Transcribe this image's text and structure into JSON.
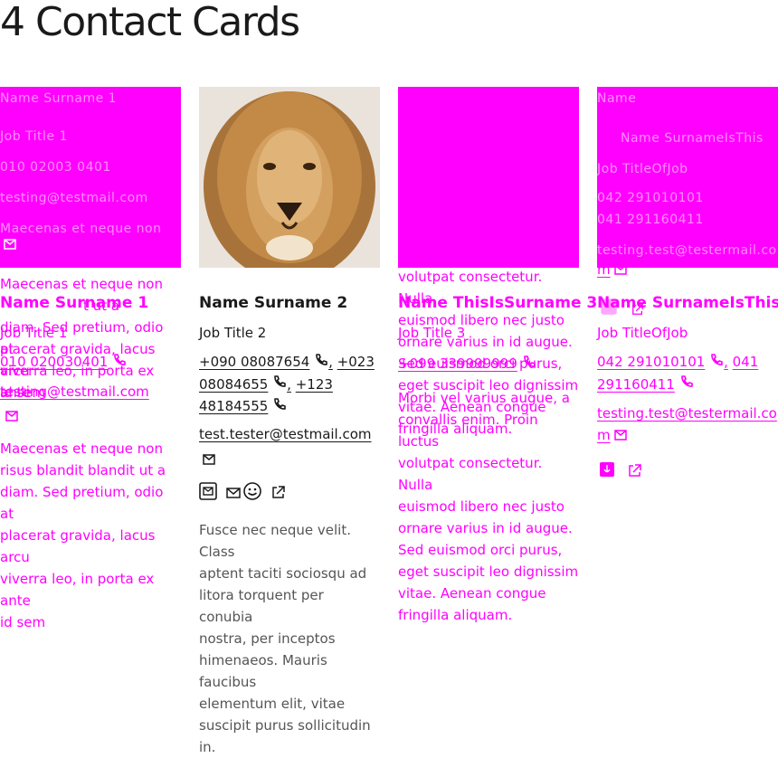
{
  "page": {
    "title": "4 Contact Cards"
  },
  "colors": {
    "missing_image": "#ff00ff",
    "text": "#1a1a1a",
    "muted": "#555555"
  },
  "icons": [
    "phone-icon",
    "mail-icon",
    "smiley-icon",
    "external-link-icon"
  ],
  "card1": {
    "glitch_lines": [
      "Name Surname 1",
      "Job Title 1",
      "010 02003 0401",
      "testing@testmail.com",
      "Maecenas et neque non"
    ],
    "text_top": "Maecenas et neque non",
    "text_top_2": "risus blandit blandit ut a",
    "name": "Name Surname 1",
    "job_title": "Job Title 1",
    "body_overlay": [
      "diam. Sed pretium, odio at",
      "placerat gravida, lacus arcu",
      "viverra leo, in porta ex ante",
      "id sem"
    ],
    "phone": "010 020030401",
    "email": "testing@testmail.com",
    "description": [
      "Maecenas et neque non",
      "risus blandit blandit ut a",
      "diam. Sed pretium, odio at",
      "placerat gravida, lacus arcu",
      "viverra leo, in porta ex ante",
      "id sem"
    ]
  },
  "card2": {
    "name": "Name Surname 2",
    "job_title": "Job Title 2",
    "phones": [
      "+090 08087654",
      "+023 08084655",
      "+123 48184555"
    ],
    "email": "test.tester@testmail.com",
    "description": [
      "Fusce nec neque velit. Class",
      "aptent taciti sociosqu ad",
      "litora torquent per conubia",
      "nostra, per inceptos",
      "himenaeos. Mauris faucibus",
      "elementum elit, vitae",
      "suscipit purus sollicitudin",
      "in."
    ]
  },
  "card3": {
    "name": "Name ThisIsSurname 3",
    "job_title": "Job Title 3",
    "phone": "+099 339999999",
    "text_lines": [
      "volutpat consectetur. Nulla",
      "euismod libero nec justo",
      "ornare varius in id augue.",
      "Sed euismod orci purus,",
      "eget suscipit leo dignissim",
      "vitae. Aenean congue",
      "fringilla aliquam.",
      "Morbi vel varius augue, a",
      "convallis enim. Proin luctus",
      "volutpat consectetur. Nulla",
      "euismod libero nec justo",
      "ornare varius in id augue.",
      "Sed euismod orci purus,",
      "eget suscipit leo dignissim",
      "vitae. Aenean congue",
      "fringilla aliquam."
    ]
  },
  "card4": {
    "glitch_lines": [
      "Name",
      "Name SurnameIsThis",
      "Job TitleOfJob",
      "042 291010101",
      "041 291160411",
      "testing.test@testermail.co",
      "m"
    ],
    "name": "Name SurnameIsThis",
    "job_title": "Job TitleOfJob",
    "phones": [
      "042 291010101",
      "041 291160411"
    ],
    "email_part1": "testing.test@testermail.co",
    "email_part2": "m"
  },
  "separators": {
    "comma": ","
  }
}
